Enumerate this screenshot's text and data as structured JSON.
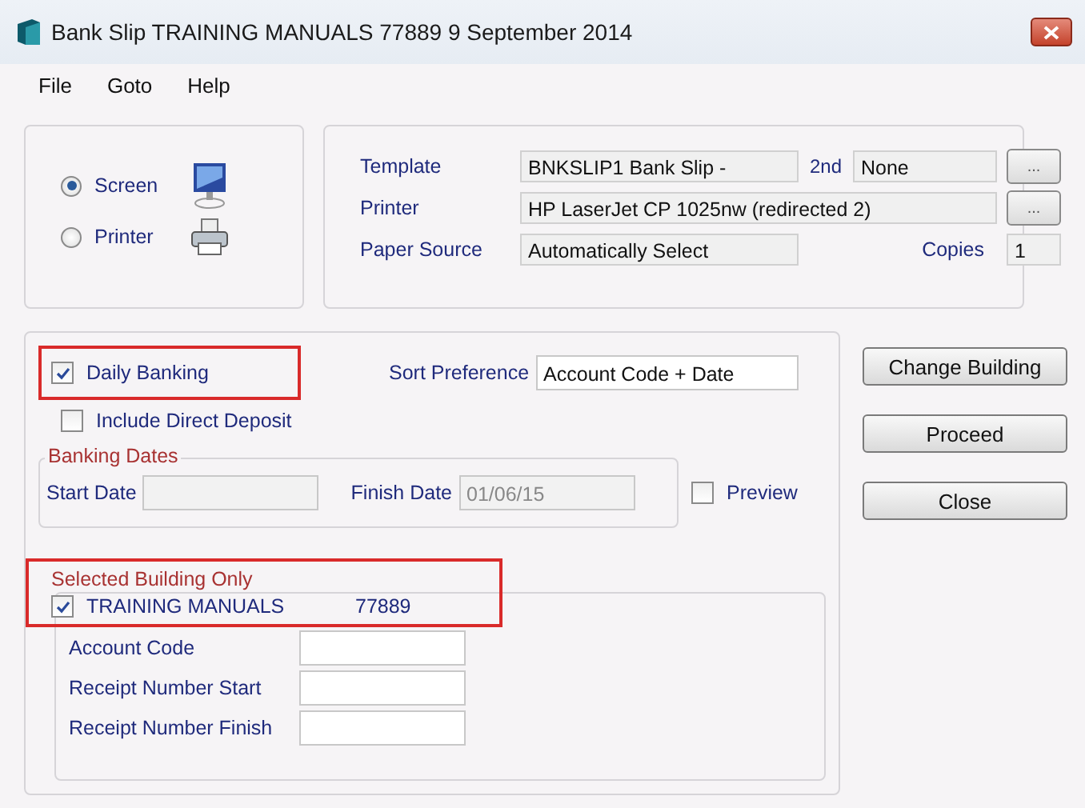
{
  "window": {
    "title": "Bank Slip TRAINING MANUALS 77889 9 September 2014"
  },
  "menu": [
    "File",
    "Goto",
    "Help"
  ],
  "output": [
    {
      "label": "Screen",
      "selected": true
    },
    {
      "label": "Printer",
      "selected": false
    }
  ],
  "print_settings": {
    "template_label": "Template",
    "template": "BNKSLIP1 Bank Slip -",
    "second_label": "2nd",
    "second": "None",
    "browse_button": "...",
    "printer_label": "Printer",
    "printer": "HP LaserJet CP 1025nw (redirected 2)",
    "paper_source_label": "Paper Source",
    "paper_source": "Automatically Select",
    "copies_label": "Copies",
    "copies": "1"
  },
  "options": {
    "daily_banking": {
      "label": "Daily Banking",
      "checked": true,
      "highlighted": true
    },
    "sort_preference_label": "Sort Preference",
    "sort_preference": "Account Code + Date",
    "include_direct_deposit": {
      "label": "Include Direct Deposit",
      "checked": false
    },
    "banking_dates": {
      "title": "Banking Dates",
      "disabled": true,
      "start_label": "Start Date",
      "finish_label": "Finish Date",
      "finish": "01/06/15"
    },
    "preview": {
      "label": "Preview",
      "checked": false
    },
    "selected_building": {
      "title": "Selected Building Only",
      "highlighted": true,
      "building": {
        "name": "TRAINING MANUALS",
        "code": "77889",
        "checked": true
      },
      "fields": [
        {
          "label": "Account Code"
        },
        {
          "label": "Receipt Number Start"
        },
        {
          "label": "Receipt Number Finish"
        }
      ]
    }
  },
  "buttons": [
    "Change Building",
    "Proceed",
    "Close"
  ]
}
